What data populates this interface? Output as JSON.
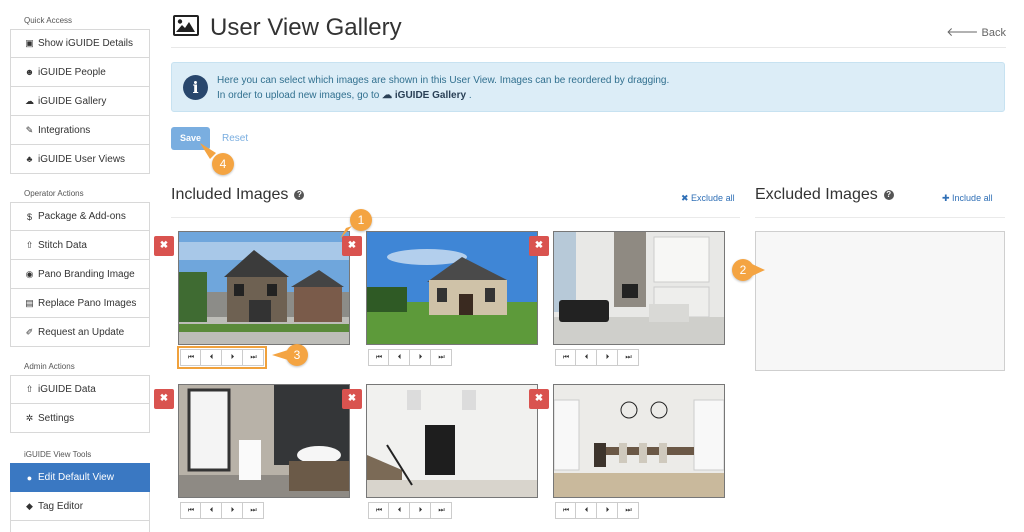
{
  "sidebar": {
    "sections": [
      {
        "label": "Quick Access",
        "items": [
          {
            "label": "Show iGUIDE Details",
            "icon": "id-card-icon",
            "glyph": "▣"
          },
          {
            "label": "iGUIDE People",
            "icon": "people-icon",
            "glyph": "☻"
          },
          {
            "label": "iGUIDE Gallery",
            "icon": "cloud-icon",
            "glyph": "☁"
          },
          {
            "label": "Integrations",
            "icon": "plug-icon",
            "glyph": "✎"
          },
          {
            "label": "iGUIDE User Views",
            "icon": "sitemap-icon",
            "glyph": "♣"
          }
        ]
      },
      {
        "label": "Operator Actions",
        "items": [
          {
            "label": "Package & Add-ons",
            "icon": "dollar-icon",
            "glyph": "$"
          },
          {
            "label": "Stitch Data",
            "icon": "upload-icon",
            "glyph": "⇧"
          },
          {
            "label": "Pano Branding Image",
            "icon": "dot-circle-icon",
            "glyph": "◉"
          },
          {
            "label": "Replace Pano Images",
            "icon": "image-file-icon",
            "glyph": "▤"
          },
          {
            "label": "Request an Update",
            "icon": "edit-icon",
            "glyph": "✐"
          }
        ]
      },
      {
        "label": "Admin Actions",
        "items": [
          {
            "label": "iGUIDE Data",
            "icon": "upload-icon",
            "glyph": "⇧"
          },
          {
            "label": "Settings",
            "icon": "gears-icon",
            "glyph": "✲"
          }
        ]
      },
      {
        "label": "iGUIDE View Tools",
        "items": [
          {
            "label": "Edit Default View",
            "icon": "globe-icon",
            "glyph": "●",
            "active": true
          },
          {
            "label": "Tag Editor",
            "icon": "tag-icon",
            "glyph": "◆"
          }
        ]
      }
    ]
  },
  "header": {
    "title": "User View Gallery",
    "back_label": "Back"
  },
  "alert": {
    "line1": "Here you can select which images are shown in this User View. Images can be reordered by dragging.",
    "line2_prefix": "In order to upload new images, go to",
    "line2_link": "iGUIDE Gallery",
    "line2_suffix": "."
  },
  "actions": {
    "save_label": "Save",
    "reset_label": "Reset"
  },
  "included": {
    "title": "Included Images",
    "exclude_all": "Exclude all"
  },
  "excluded": {
    "title": "Excluded Images",
    "include_all": "Include all"
  },
  "controls": {
    "first": "⏮",
    "prev": "⏴",
    "next": "⏵",
    "last": "⏭"
  },
  "remove_glyph": "✖",
  "images": [
    {
      "name": "house-front-exterior",
      "scene": "exterior1"
    },
    {
      "name": "house-side-exterior",
      "scene": "exterior2"
    },
    {
      "name": "living-room-fireplace",
      "scene": "living"
    },
    {
      "name": "bathroom-vanity",
      "scene": "bath"
    },
    {
      "name": "foyer-stairs",
      "scene": "foyer"
    },
    {
      "name": "dining-room",
      "scene": "dining"
    }
  ],
  "callouts": [
    "1",
    "2",
    "3",
    "4"
  ],
  "colors": {
    "accent": "#3a78c2",
    "save": "#7aaee0",
    "danger": "#d9534f",
    "callout": "#f4a442",
    "alert_bg": "#dcedf7"
  }
}
